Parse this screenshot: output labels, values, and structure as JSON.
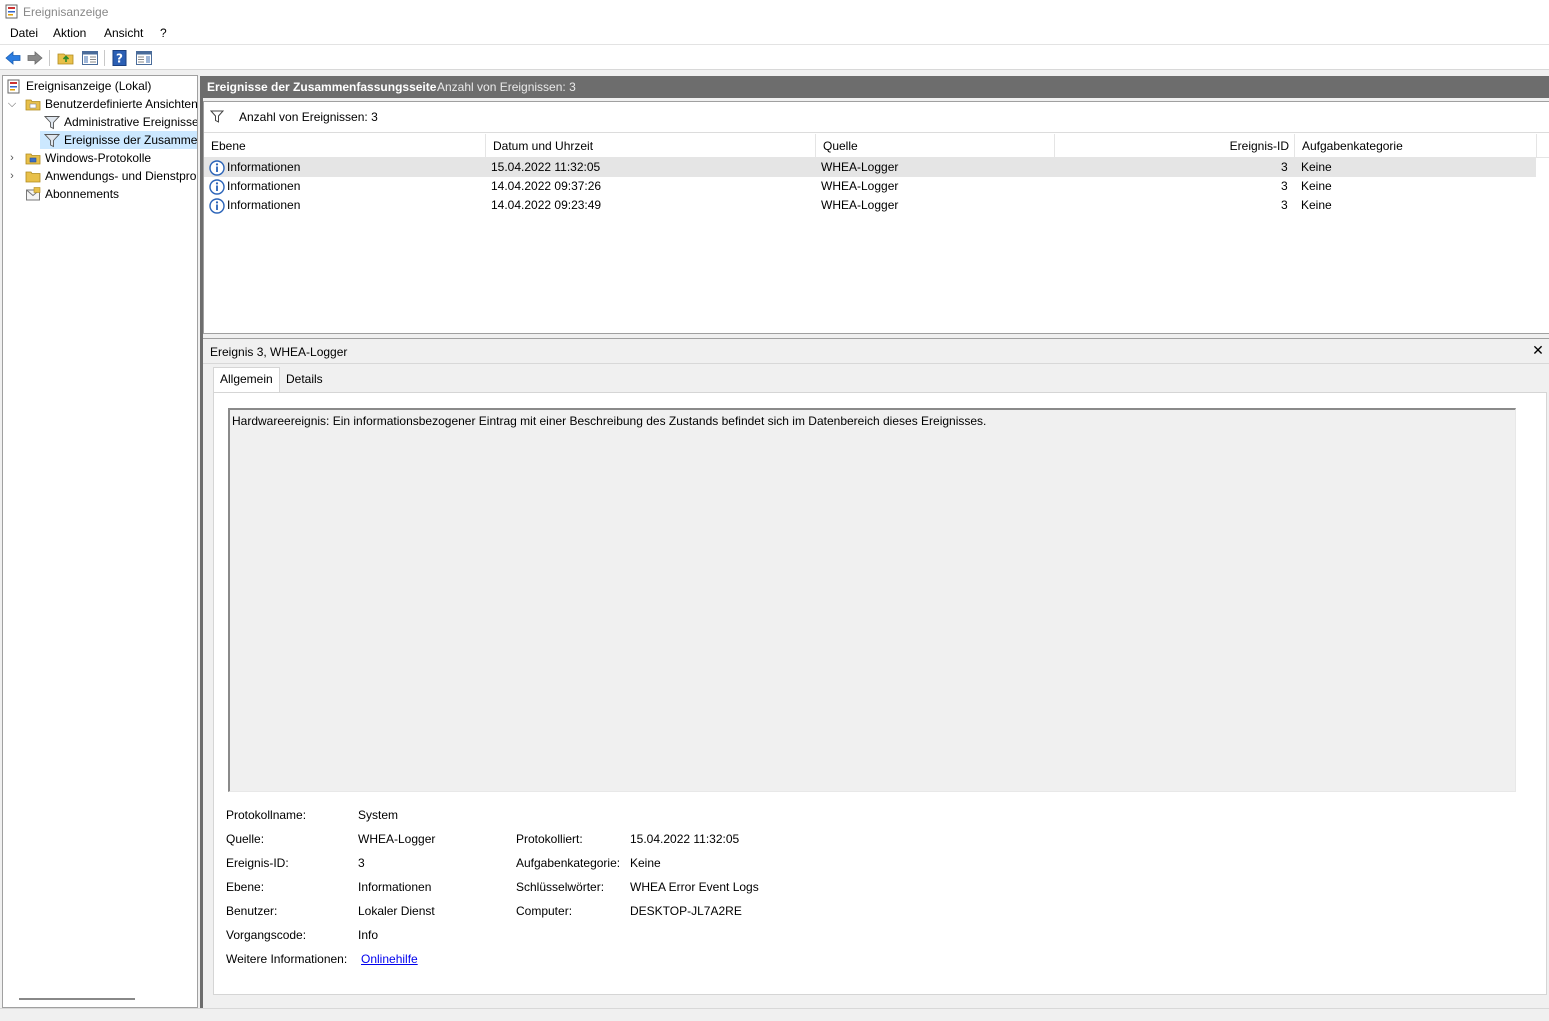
{
  "window": {
    "title": "Ereignisanzeige"
  },
  "menu": {
    "items": [
      "Datei",
      "Aktion",
      "Ansicht",
      "?"
    ]
  },
  "toolbar": {
    "buttons": [
      "back-arrow-icon",
      "forward-arrow-icon",
      "folder-up-icon",
      "show-hide-tree-icon",
      "help-icon",
      "show-hide-action-icon"
    ]
  },
  "tree": {
    "root": "Ereignisanzeige (Lokal)",
    "custom_views": "Benutzerdefinierte Ansichten",
    "admin_events": "Administrative Ereignisse",
    "summary_events": "Ereignisse der Zusammen",
    "windows_logs": "Windows-Protokolle",
    "app_service_logs": "Anwendungs- und Dienstpro",
    "subscriptions": "Abonnements"
  },
  "header": {
    "title": "Ereignisse der Zusammenfassungsseite",
    "count": "Anzahl von Ereignissen: 3"
  },
  "filter": {
    "text": "Anzahl von Ereignissen: 3"
  },
  "columns": {
    "level": "Ebene",
    "datetime": "Datum und Uhrzeit",
    "source": "Quelle",
    "event_id": "Ereignis-ID",
    "task_category": "Aufgabenkategorie"
  },
  "events": [
    {
      "level": "Informationen",
      "datetime": "15.04.2022 11:32:05",
      "source": "WHEA-Logger",
      "event_id": "3",
      "task_category": "Keine"
    },
    {
      "level": "Informationen",
      "datetime": "14.04.2022 09:37:26",
      "source": "WHEA-Logger",
      "event_id": "3",
      "task_category": "Keine"
    },
    {
      "level": "Informationen",
      "datetime": "14.04.2022 09:23:49",
      "source": "WHEA-Logger",
      "event_id": "3",
      "task_category": "Keine"
    }
  ],
  "detail": {
    "title": "Ereignis 3, WHEA-Logger",
    "close": "✕",
    "tabs": {
      "general": "Allgemein",
      "details": "Details"
    },
    "message": "Hardwareereignis: Ein informationsbezogener Eintrag mit einer Beschreibung des Zustands befindet sich im Datenbereich dieses Ereignisses.",
    "labels": {
      "log_name": "Protokollname:",
      "source": "Quelle:",
      "event_id": "Ereignis-ID:",
      "level": "Ebene:",
      "user": "Benutzer:",
      "opcode": "Vorgangscode:",
      "more_info": "Weitere Informationen:",
      "logged": "Protokolliert:",
      "task_category": "Aufgabenkategorie:",
      "keywords": "Schlüsselwörter:",
      "computer": "Computer:"
    },
    "values": {
      "log_name": "System",
      "source": "WHEA-Logger",
      "event_id": "3",
      "level": "Informationen",
      "user": "Lokaler Dienst",
      "opcode": "Info",
      "more_info": "Onlinehilfe",
      "logged": "15.04.2022 11:32:05",
      "task_category": "Keine",
      "keywords": "WHEA Error Event Logs",
      "computer": "DESKTOP-JL7A2RE"
    }
  }
}
